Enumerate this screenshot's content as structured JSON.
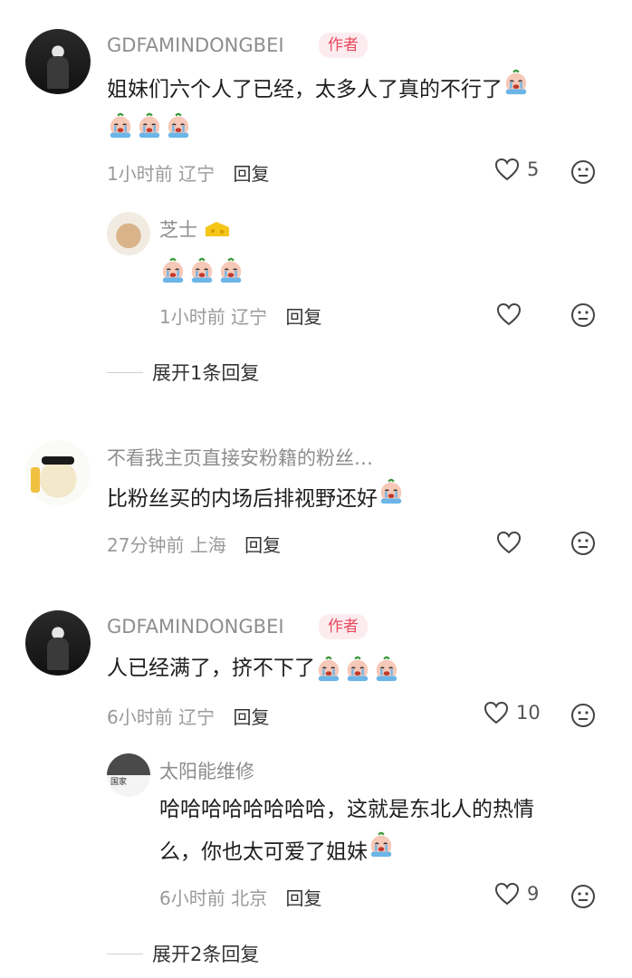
{
  "comments": [
    {
      "user": "GDFAMINDONGBEI",
      "badge": "作者",
      "text": "姐妹们六个人了已经，太多人了真的不行了",
      "time": "1小时前",
      "location": "辽宁",
      "reply": "回复",
      "likes": "5",
      "replies": [
        {
          "user": "芝士",
          "time": "1小时前",
          "location": "辽宁",
          "reply": "回复"
        }
      ],
      "expand": "展开1条回复"
    },
    {
      "user": "不看我主页直接安粉籍的粉丝…",
      "text": "比粉丝买的内场后排视野还好",
      "time": "27分钟前",
      "location": "上海",
      "reply": "回复"
    },
    {
      "user": "GDFAMINDONGBEI",
      "badge": "作者",
      "text": "人已经满了，挤不下了",
      "time": "6小时前",
      "location": "辽宁",
      "reply": "回复",
      "likes": "10",
      "replies": [
        {
          "user": "太阳能维修",
          "text_line1": "哈哈哈哈哈哈哈哈，这就是东北人的热情",
          "text_line2": "么，你也太可爱了姐妹",
          "time": "6小时前",
          "location": "北京",
          "reply": "回复",
          "likes": "9"
        }
      ],
      "expand": "展开2条回复"
    }
  ],
  "icons": {
    "like": "heart-outline-icon",
    "dislike": "meh-face-icon",
    "emoji": "crying-emoji"
  },
  "colors": {
    "author_badge": "#e84a5f",
    "meta": "#9a9a9a"
  }
}
